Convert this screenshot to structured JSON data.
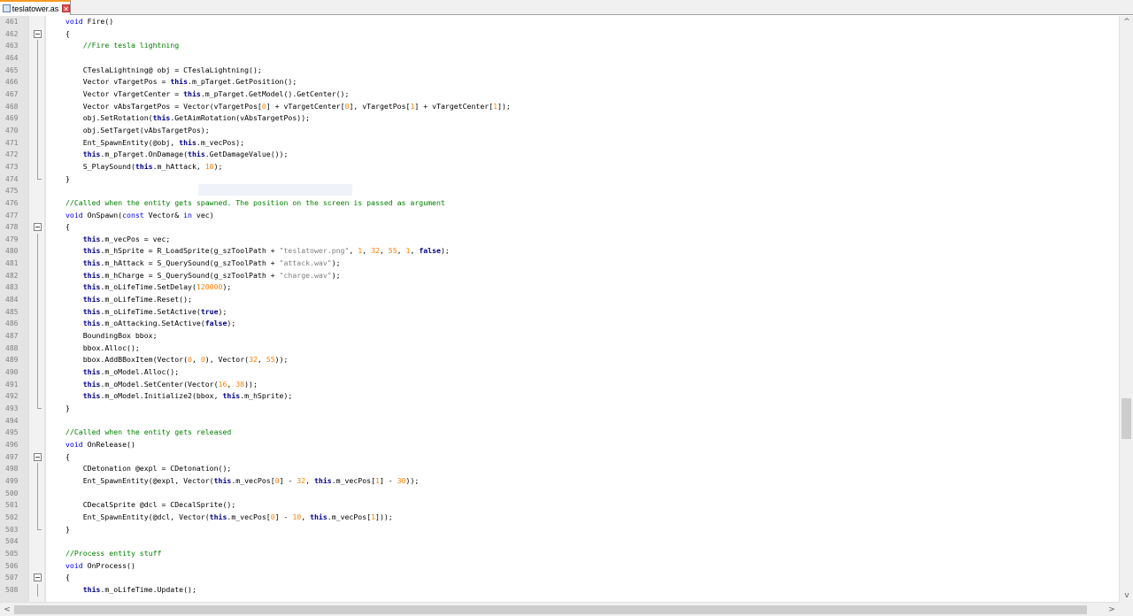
{
  "tab": {
    "label": "teslatower.as",
    "close_glyph": "✕"
  },
  "scroll": {
    "up": "^",
    "down": "v",
    "left": "<",
    "right": ">"
  },
  "code": [
    {
      "n": "461",
      "fold": "none",
      "t": [
        {
          "c": "k",
          "v": "void"
        },
        {
          "v": " Fire()"
        }
      ]
    },
    {
      "n": "462",
      "fold": "start",
      "t": [
        {
          "v": "{"
        }
      ]
    },
    {
      "n": "463",
      "fold": "line",
      "t": [
        {
          "v": "    "
        },
        {
          "c": "c",
          "v": "//Fire tesla lightning"
        }
      ]
    },
    {
      "n": "464",
      "fold": "line",
      "t": []
    },
    {
      "n": "465",
      "fold": "line",
      "t": [
        {
          "v": "    CTeslaLightning@ obj = CTeslaLightning();"
        }
      ]
    },
    {
      "n": "466",
      "fold": "line",
      "t": [
        {
          "v": "    Vector vTargetPos = "
        },
        {
          "c": "k2",
          "v": "this"
        },
        {
          "v": ".m_pTarget.GetPosition();"
        }
      ]
    },
    {
      "n": "467",
      "fold": "line",
      "t": [
        {
          "v": "    Vector vTargetCenter = "
        },
        {
          "c": "k2",
          "v": "this"
        },
        {
          "v": ".m_pTarget.GetModel().GetCenter();"
        }
      ]
    },
    {
      "n": "468",
      "fold": "line",
      "t": [
        {
          "v": "    Vector vAbsTargetPos = Vector(vTargetPos["
        },
        {
          "c": "n",
          "v": "0"
        },
        {
          "v": "] + vTargetCenter["
        },
        {
          "c": "n",
          "v": "0"
        },
        {
          "v": "], vTargetPos["
        },
        {
          "c": "n",
          "v": "1"
        },
        {
          "v": "] + vTargetCenter["
        },
        {
          "c": "n",
          "v": "1"
        },
        {
          "v": "]);"
        }
      ]
    },
    {
      "n": "469",
      "fold": "line",
      "t": [
        {
          "v": "    obj.SetRotation("
        },
        {
          "c": "k2",
          "v": "this"
        },
        {
          "v": ".GetAimRotation(vAbsTargetPos));"
        }
      ]
    },
    {
      "n": "470",
      "fold": "line",
      "t": [
        {
          "v": "    obj.SetTarget(vAbsTargetPos);"
        }
      ]
    },
    {
      "n": "471",
      "fold": "line",
      "t": [
        {
          "v": "    Ent_SpawnEntity(@obj, "
        },
        {
          "c": "k2",
          "v": "this"
        },
        {
          "v": ".m_vecPos);"
        }
      ]
    },
    {
      "n": "472",
      "fold": "line",
      "t": [
        {
          "v": "    "
        },
        {
          "c": "k2",
          "v": "this"
        },
        {
          "v": ".m_pTarget.OnDamage("
        },
        {
          "c": "k2",
          "v": "this"
        },
        {
          "v": ".GetDamageValue());"
        }
      ]
    },
    {
      "n": "473",
      "fold": "line",
      "t": [
        {
          "v": "    S_PlaySound("
        },
        {
          "c": "k2",
          "v": "this"
        },
        {
          "v": ".m_hAttack, "
        },
        {
          "c": "n",
          "v": "10"
        },
        {
          "v": ");"
        }
      ]
    },
    {
      "n": "474",
      "fold": "end",
      "t": [
        {
          "v": "}"
        }
      ]
    },
    {
      "n": "475",
      "fold": "none",
      "t": []
    },
    {
      "n": "476",
      "fold": "none",
      "t": [
        {
          "c": "c",
          "v": "//Called when the entity gets spawned. The position on the screen is passed as argument"
        }
      ]
    },
    {
      "n": "477",
      "fold": "none",
      "t": [
        {
          "c": "k",
          "v": "void"
        },
        {
          "v": " OnSpawn("
        },
        {
          "c": "k",
          "v": "const"
        },
        {
          "v": " Vector& "
        },
        {
          "c": "k",
          "v": "in"
        },
        {
          "v": " vec)"
        }
      ]
    },
    {
      "n": "478",
      "fold": "start",
      "t": [
        {
          "v": "{"
        }
      ]
    },
    {
      "n": "479",
      "fold": "line",
      "t": [
        {
          "v": "    "
        },
        {
          "c": "k2",
          "v": "this"
        },
        {
          "v": ".m_vecPos = vec;"
        }
      ]
    },
    {
      "n": "480",
      "fold": "line",
      "t": [
        {
          "v": "    "
        },
        {
          "c": "k2",
          "v": "this"
        },
        {
          "v": ".m_hSprite = R_LoadSprite(g_szToolPath + "
        },
        {
          "c": "s",
          "v": "\"teslatower.png\""
        },
        {
          "v": ", "
        },
        {
          "c": "n",
          "v": "1"
        },
        {
          "v": ", "
        },
        {
          "c": "n",
          "v": "32"
        },
        {
          "v": ", "
        },
        {
          "c": "n",
          "v": "55"
        },
        {
          "v": ", "
        },
        {
          "c": "n",
          "v": "1"
        },
        {
          "v": ", "
        },
        {
          "c": "k2",
          "v": "false"
        },
        {
          "v": ");"
        }
      ]
    },
    {
      "n": "481",
      "fold": "line",
      "t": [
        {
          "v": "    "
        },
        {
          "c": "k2",
          "v": "this"
        },
        {
          "v": ".m_hAttack = S_QuerySound(g_szToolPath + "
        },
        {
          "c": "s",
          "v": "\"attack.wav\""
        },
        {
          "v": ");"
        }
      ]
    },
    {
      "n": "482",
      "fold": "line",
      "t": [
        {
          "v": "    "
        },
        {
          "c": "k2",
          "v": "this"
        },
        {
          "v": ".m_hCharge = S_QuerySound(g_szToolPath + "
        },
        {
          "c": "s",
          "v": "\"charge.wav\""
        },
        {
          "v": ");"
        }
      ]
    },
    {
      "n": "483",
      "fold": "line",
      "t": [
        {
          "v": "    "
        },
        {
          "c": "k2",
          "v": "this"
        },
        {
          "v": ".m_oLifeTime.SetDelay("
        },
        {
          "c": "n",
          "v": "120000"
        },
        {
          "v": ");"
        }
      ]
    },
    {
      "n": "484",
      "fold": "line",
      "t": [
        {
          "v": "    "
        },
        {
          "c": "k2",
          "v": "this"
        },
        {
          "v": ".m_oLifeTime.Reset();"
        }
      ]
    },
    {
      "n": "485",
      "fold": "line",
      "t": [
        {
          "v": "    "
        },
        {
          "c": "k2",
          "v": "this"
        },
        {
          "v": ".m_oLifeTime.SetActive("
        },
        {
          "c": "k2",
          "v": "true"
        },
        {
          "v": ");"
        }
      ]
    },
    {
      "n": "486",
      "fold": "line",
      "t": [
        {
          "v": "    "
        },
        {
          "c": "k2",
          "v": "this"
        },
        {
          "v": ".m_oAttacking.SetActive("
        },
        {
          "c": "k2",
          "v": "false"
        },
        {
          "v": ");"
        }
      ]
    },
    {
      "n": "487",
      "fold": "line",
      "t": [
        {
          "v": "    BoundingBox bbox;"
        }
      ]
    },
    {
      "n": "488",
      "fold": "line",
      "t": [
        {
          "v": "    bbox.Alloc();"
        }
      ]
    },
    {
      "n": "489",
      "fold": "line",
      "t": [
        {
          "v": "    bbox.AddBBoxItem(Vector("
        },
        {
          "c": "n",
          "v": "0"
        },
        {
          "v": ", "
        },
        {
          "c": "n",
          "v": "0"
        },
        {
          "v": "), Vector("
        },
        {
          "c": "n",
          "v": "32"
        },
        {
          "v": ", "
        },
        {
          "c": "n",
          "v": "55"
        },
        {
          "v": "));"
        }
      ]
    },
    {
      "n": "490",
      "fold": "line",
      "t": [
        {
          "v": "    "
        },
        {
          "c": "k2",
          "v": "this"
        },
        {
          "v": ".m_oModel.Alloc();"
        }
      ]
    },
    {
      "n": "491",
      "fold": "line",
      "t": [
        {
          "v": "    "
        },
        {
          "c": "k2",
          "v": "this"
        },
        {
          "v": ".m_oModel.SetCenter(Vector("
        },
        {
          "c": "n",
          "v": "16"
        },
        {
          "v": ", "
        },
        {
          "c": "n",
          "v": "38"
        },
        {
          "v": "));"
        }
      ]
    },
    {
      "n": "492",
      "fold": "line",
      "t": [
        {
          "v": "    "
        },
        {
          "c": "k2",
          "v": "this"
        },
        {
          "v": ".m_oModel.Initialize2(bbox, "
        },
        {
          "c": "k2",
          "v": "this"
        },
        {
          "v": ".m_hSprite);"
        }
      ]
    },
    {
      "n": "493",
      "fold": "end",
      "t": [
        {
          "v": "}"
        }
      ]
    },
    {
      "n": "494",
      "fold": "none",
      "t": []
    },
    {
      "n": "495",
      "fold": "none",
      "t": [
        {
          "c": "c",
          "v": "//Called when the entity gets released"
        }
      ]
    },
    {
      "n": "496",
      "fold": "none",
      "t": [
        {
          "c": "k",
          "v": "void"
        },
        {
          "v": " OnRelease()"
        }
      ]
    },
    {
      "n": "497",
      "fold": "start",
      "t": [
        {
          "v": "{"
        }
      ]
    },
    {
      "n": "498",
      "fold": "line",
      "t": [
        {
          "v": "    CDetonation @expl = CDetonation();"
        }
      ]
    },
    {
      "n": "499",
      "fold": "line",
      "t": [
        {
          "v": "    Ent_SpawnEntity(@expl, Vector("
        },
        {
          "c": "k2",
          "v": "this"
        },
        {
          "v": ".m_vecPos["
        },
        {
          "c": "n",
          "v": "0"
        },
        {
          "v": "] - "
        },
        {
          "c": "n",
          "v": "32"
        },
        {
          "v": ", "
        },
        {
          "c": "k2",
          "v": "this"
        },
        {
          "v": ".m_vecPos["
        },
        {
          "c": "n",
          "v": "1"
        },
        {
          "v": "] - "
        },
        {
          "c": "n",
          "v": "30"
        },
        {
          "v": "));"
        }
      ]
    },
    {
      "n": "500",
      "fold": "line",
      "t": []
    },
    {
      "n": "501",
      "fold": "line",
      "t": [
        {
          "v": "    CDecalSprite @dcl = CDecalSprite();"
        }
      ]
    },
    {
      "n": "502",
      "fold": "line",
      "t": [
        {
          "v": "    Ent_SpawnEntity(@dcl, Vector("
        },
        {
          "c": "k2",
          "v": "this"
        },
        {
          "v": ".m_vecPos["
        },
        {
          "c": "n",
          "v": "0"
        },
        {
          "v": "] - "
        },
        {
          "c": "n",
          "v": "10"
        },
        {
          "v": ", "
        },
        {
          "c": "k2",
          "v": "this"
        },
        {
          "v": ".m_vecPos["
        },
        {
          "c": "n",
          "v": "1"
        },
        {
          "v": "]));"
        }
      ]
    },
    {
      "n": "503",
      "fold": "end",
      "t": [
        {
          "v": "}"
        }
      ]
    },
    {
      "n": "504",
      "fold": "none",
      "t": []
    },
    {
      "n": "505",
      "fold": "none",
      "t": [
        {
          "c": "c",
          "v": "//Process entity stuff"
        }
      ]
    },
    {
      "n": "506",
      "fold": "none",
      "t": [
        {
          "c": "k",
          "v": "void"
        },
        {
          "v": " OnProcess()"
        }
      ]
    },
    {
      "n": "507",
      "fold": "start",
      "t": [
        {
          "v": "{"
        }
      ]
    },
    {
      "n": "508",
      "fold": "line",
      "t": [
        {
          "v": "    "
        },
        {
          "c": "k2",
          "v": "this"
        },
        {
          "v": ".m_oLifeTime.Update();"
        }
      ]
    }
  ]
}
